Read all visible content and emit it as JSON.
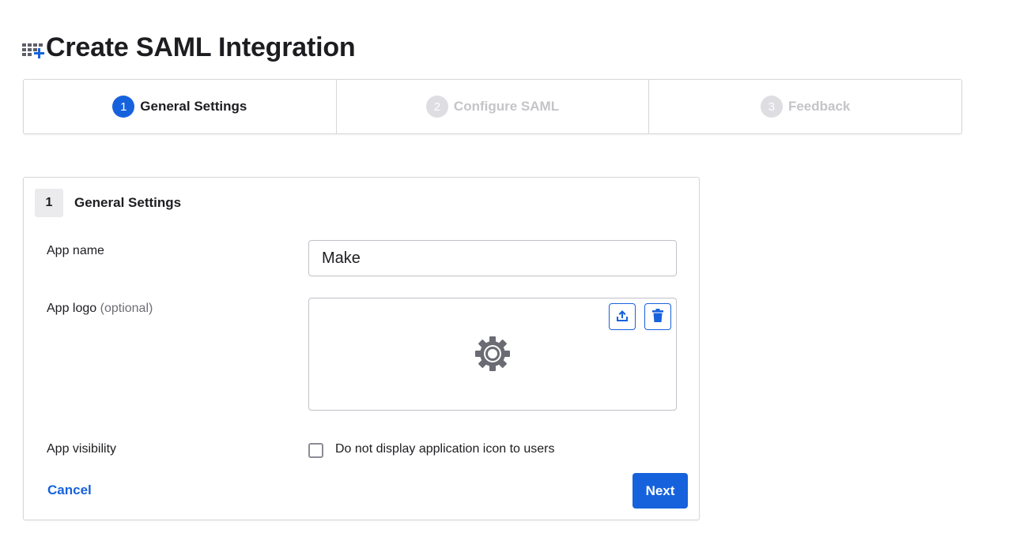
{
  "header": {
    "title": "Create SAML Integration",
    "icon": "app-grid-add-icon"
  },
  "stepper": {
    "steps": [
      {
        "number": "1",
        "label": "General Settings",
        "state": "active"
      },
      {
        "number": "2",
        "label": "Configure SAML",
        "state": "inactive"
      },
      {
        "number": "3",
        "label": "Feedback",
        "state": "inactive"
      }
    ]
  },
  "section": {
    "number": "1",
    "title": "General Settings"
  },
  "form": {
    "app_name": {
      "label": "App name",
      "value": "Make"
    },
    "app_logo": {
      "label": "App logo",
      "optional": "(optional)",
      "icons": [
        "upload-icon",
        "trash-icon",
        "gear-icon"
      ]
    },
    "app_visibility": {
      "label": "App visibility",
      "checkbox_label": "Do not display application icon to users",
      "checked": false
    }
  },
  "actions": {
    "cancel_label": "Cancel",
    "next_label": "Next"
  },
  "colors": {
    "accent": "#1662dd",
    "inactive_step": "#c4c4c9",
    "border": "#d7d7dc"
  }
}
